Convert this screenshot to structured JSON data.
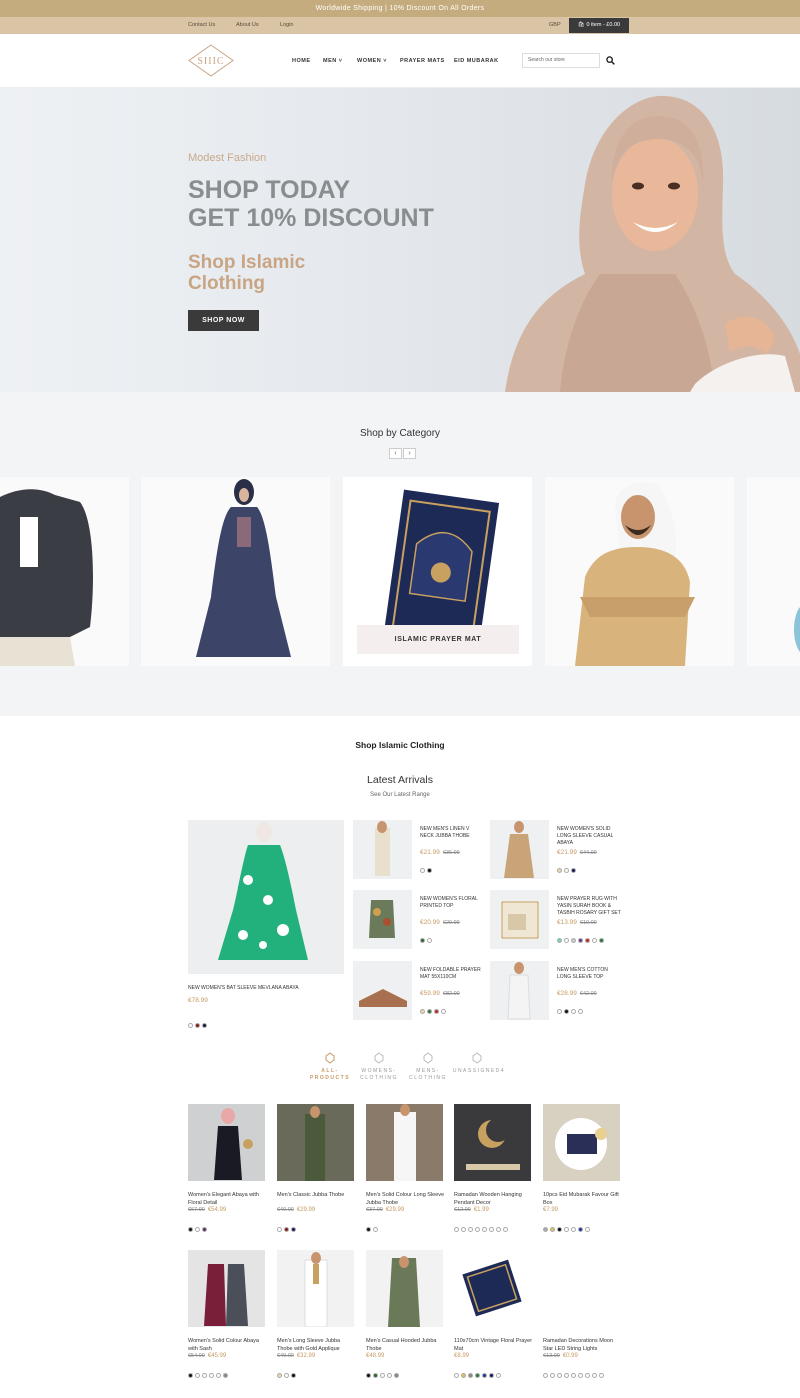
{
  "announcement": "Worldwide Shipping | 10% Discount On All Orders",
  "topbar": {
    "links": [
      "Contact Us",
      "About Us",
      "Login"
    ],
    "currency": "GBP",
    "cart": "0 item - £0.00"
  },
  "logo_text": "SIIIC",
  "nav": [
    {
      "label": "HOME"
    },
    {
      "label": "MEN",
      "dropdown": true
    },
    {
      "label": "WOMEN",
      "dropdown": true
    },
    {
      "label": "PRAYER MATS"
    },
    {
      "label": "EID MUBARAK"
    }
  ],
  "search": {
    "placeholder": "Search our store"
  },
  "hero": {
    "eyebrow": "Modest Fashion",
    "headline_1": "SHOP TODAY",
    "headline_2": "GET 10% DISCOUNT",
    "sub_1": "Shop Islamic",
    "sub_2": "Clothing",
    "button": "SHOP NOW"
  },
  "categories": {
    "title": "Shop by Category",
    "prev": "‹",
    "next": "›",
    "active_label": "ISLAMIC PRAYER MAT"
  },
  "shop_heading": "Shop Islamic Clothing",
  "latest": {
    "title": "Latest Arrivals",
    "subtitle": "See Our Latest Range",
    "featured": {
      "name": "NEW WOMEN'S BAT SLEEVE MEVLANA ABAYA",
      "price": "€78.99",
      "swatches": [
        "#ffffff",
        "#8b1a1a",
        "#1a1a3a"
      ]
    },
    "items": [
      {
        "name": "NEW MEN'S LINEN V NECK JUBBA THOBE",
        "price": "€21.99",
        "old": "€36.99",
        "swatches": [
          "#ffffff",
          "#111111"
        ]
      },
      {
        "name": "NEW WOMEN'S SOLID LONG SLEEVE CASUAL ABAYA",
        "price": "€21.99",
        "old": "€44.00",
        "swatches": [
          "#e8d7a8",
          "#ffffff",
          "#1a1a5a"
        ]
      },
      {
        "name": "NEW WOMEN'S FLORAL PRINTED TOP",
        "price": "€20.99",
        "old": "€29.99",
        "swatches": [
          "#2a6a2a",
          "#ffffff"
        ]
      },
      {
        "name": "NEW PRAYER RUG WITH YASIN SURAH BOOK & TASBIH ROSARY GIFT SET",
        "price": "€13.99",
        "old": "€19.00",
        "swatches": [
          "#7ad0c0",
          "#ffffff",
          "#cccccc",
          "#6a3a8a",
          "#c02a2a",
          "#ffffff",
          "#2a7a3a"
        ]
      },
      {
        "name": "NEW FOLDABLE PRAYER MAT 55X110CM",
        "price": "€59.99",
        "old": "€82.00",
        "swatches": [
          "#e8d7a8",
          "#2a7a3a",
          "#c02a2a",
          "#ffffff"
        ]
      },
      {
        "name": "NEW MEN'S COTTON LONG SLEEVE TOP",
        "price": "€28.99",
        "old": "€42.00",
        "swatches": [
          "#ffffff",
          "#111111",
          "#ffffff",
          "#ffffff"
        ]
      }
    ]
  },
  "tabs": [
    {
      "label": "ALL-PRODUCTS",
      "active": true
    },
    {
      "label": "WOMENS-CLOTHING"
    },
    {
      "label": "MENS-CLOTHING"
    },
    {
      "label": "UNASSIGNED4"
    }
  ],
  "products_row1": [
    {
      "name": "Women's Elegant Abaya with Floral Detail",
      "old": "€67.90",
      "price": "€54.99",
      "swatches": [
        "#111111",
        "#ffffff",
        "#6a2a6a"
      ]
    },
    {
      "name": "Men's Classic Jubba Thobe",
      "old": "€40.00",
      "price": "€29.99",
      "swatches": [
        "#ffffff",
        "#8b1a1a",
        "#1a1a5a"
      ]
    },
    {
      "name": "Men's Solid Colour Long Sleeve Jubba Thobe",
      "old": "€37.00",
      "price": "€29.99",
      "swatches": [
        "#111111",
        "#ffffff"
      ]
    },
    {
      "name": "Ramadan Wooden Hanging Pendant Decor",
      "old": "€12.99",
      "price": "€1.99",
      "swatches": [
        "#ffffff",
        "#ffffff",
        "#ffffff",
        "#ffffff",
        "#ffffff",
        "#ffffff",
        "#ffffff",
        "#ffffff"
      ]
    },
    {
      "name": "10pcs Eid Mubarak Favour Gift Box",
      "old": "",
      "price": "€7.99",
      "swatches": [
        "#aaaaaa",
        "#e0c060",
        "#111111",
        "#ffffff",
        "#ffffff",
        "#1a3aa0",
        "#ffffff"
      ]
    }
  ],
  "products_row2": [
    {
      "name": "Women's Solid Colour Abaya with Sash",
      "old": "€54.00",
      "price": "€45.99",
      "swatches": [
        "#111111",
        "#ffffff",
        "#ffffff",
        "#ffffff",
        "#ffffff",
        "#888888"
      ]
    },
    {
      "name": "Men's Long Sleeve Jubba Thobe with Gold Applique",
      "old": "€40.00",
      "price": "€32.99",
      "swatches": [
        "#e8d7a8",
        "#ffffff",
        "#111111"
      ]
    },
    {
      "name": "Men's Casual Hooded Jubba Thobe",
      "old": "",
      "price": "€48.99",
      "swatches": [
        "#111111",
        "#2a6a2a",
        "#ffffff",
        "#ffffff",
        "#888888"
      ]
    },
    {
      "name": "110x70cm Vintage Floral Prayer Mat",
      "old": "",
      "price": "€8.99",
      "swatches": [
        "#ffffff",
        "#e0c060",
        "#888888",
        "#2a7a3a",
        "#1a3aa0",
        "#1a1a5a",
        "#ffffff"
      ]
    },
    {
      "name": "Ramadan Decorations Moon Star LED String Lights",
      "old": "€13.00",
      "price": "€0.99",
      "swatches": [
        "#ffffff",
        "#ffffff",
        "#ffffff",
        "#ffffff",
        "#ffffff",
        "#ffffff",
        "#ffffff",
        "#ffffff",
        "#ffffff"
      ]
    }
  ]
}
